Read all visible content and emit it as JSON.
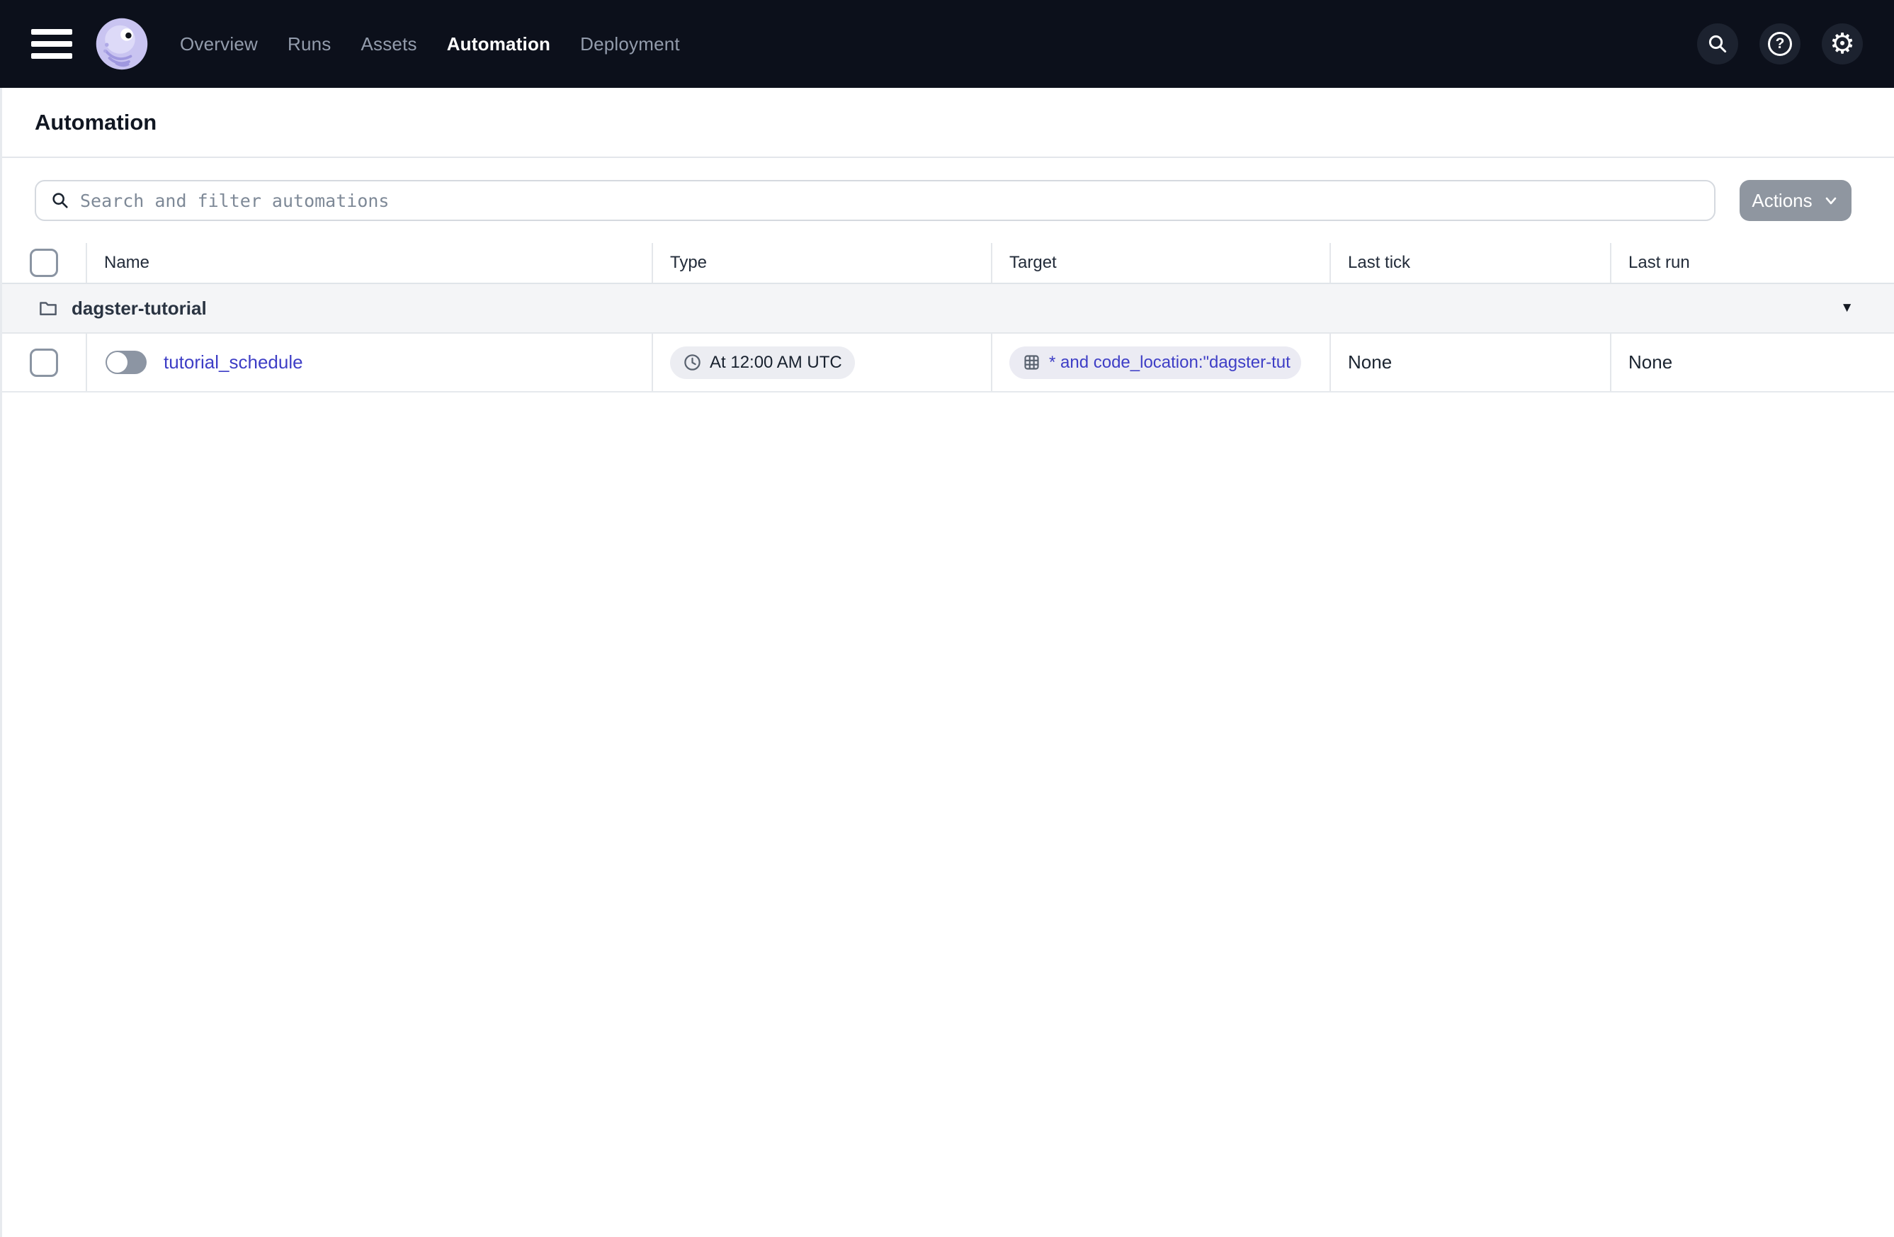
{
  "nav": {
    "items": [
      {
        "label": "Overview",
        "active": false
      },
      {
        "label": "Runs",
        "active": false
      },
      {
        "label": "Assets",
        "active": false
      },
      {
        "label": "Automation",
        "active": true
      },
      {
        "label": "Deployment",
        "active": false
      }
    ],
    "icons": [
      "search-icon",
      "help-icon",
      "settings-gear-icon"
    ],
    "help_glyph": "?",
    "gear_glyph": "⚙"
  },
  "page": {
    "title": "Automation"
  },
  "toolbar": {
    "search_placeholder": "Search and filter automations",
    "search_value": "",
    "actions_label": "Actions"
  },
  "table": {
    "columns": [
      "Name",
      "Type",
      "Target",
      "Last tick",
      "Last run"
    ],
    "group": {
      "name": "dagster-tutorial",
      "caret": "▼"
    },
    "rows": [
      {
        "name": "tutorial_schedule",
        "enabled": false,
        "type_label": "At 12:00 AM UTC",
        "target_label": "* and code_location:\"dagster-tut",
        "last_tick": "None",
        "last_run": "None"
      }
    ]
  },
  "colors": {
    "nav_bg": "#0C101B",
    "nav_icon_circle": "#1C222F",
    "link_indigo": "#3E3EC6",
    "badge_bg": "#ECEDF2",
    "group_row_bg": "#F4F5F7",
    "actions_button_bg": "#8F96A0",
    "toggle_track": "#8C95A3",
    "border": "#E4E7EB"
  }
}
